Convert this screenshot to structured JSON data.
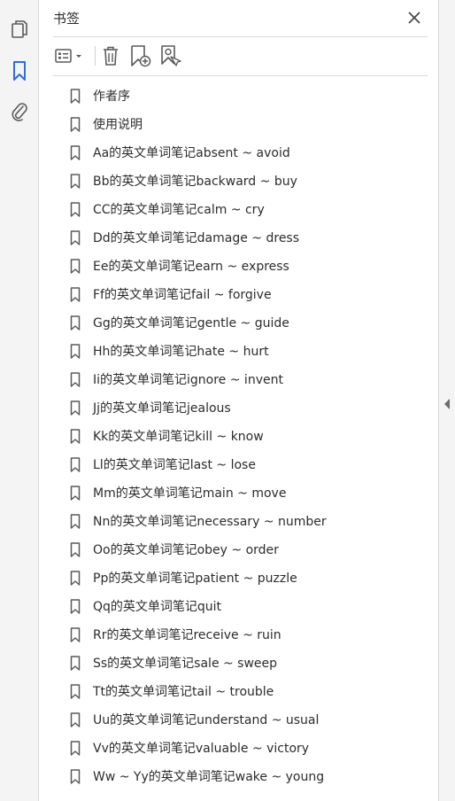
{
  "panel": {
    "title": "书签"
  },
  "bookmarks": [
    "作者序",
    "使用说明",
    "Aa的英文单词笔记absent ~ avoid",
    "Bb的英文单词笔记backward ~ buy",
    "CC的英文单词笔记calm ~ cry",
    "Dd的英文单词笔记damage ~ dress",
    "Ee的英文单词笔记earn ~ express",
    "Ff的英文单词笔记fail ~ forgive",
    "Gg的英文单词笔记gentle ~ guide",
    "Hh的英文单词笔记hate ~ hurt",
    "Ii的英文单词笔记ignore ~ invent",
    "Jj的英文单词笔记jealous",
    "Kk的英文单词笔记kill ~ know",
    "Ll的英文单词笔记last ~ lose",
    "Mm的英文单词笔记main ~ move",
    "Nn的英文单词笔记necessary ~ number",
    "Oo的英文单词笔记obey ~ order",
    "Pp的英文单词笔记patient ~ puzzle",
    "Qq的英文单词笔记quit",
    "Rr的英文单词笔记receive ~ ruin",
    "Ss的英文单词笔记sale ~ sweep",
    "Tt的英文单词笔记tail ~ trouble",
    "Uu的英文单词笔记understand ~ usual",
    "Vv的英文单词笔记valuable ~ victory",
    "Ww ~ Yy的英文单词笔记wake ~ young"
  ],
  "colors": {
    "accent": "#2f6fd6",
    "icon": "#5a5a5a",
    "rail_bg": "#f4f4f4"
  },
  "icons": {
    "rail": [
      "pages-icon",
      "bookmark-icon",
      "attachment-icon"
    ],
    "toolbar": [
      "options-icon",
      "delete-icon",
      "new-bookmark-icon",
      "find-bookmark-icon"
    ],
    "close": "close-icon"
  }
}
